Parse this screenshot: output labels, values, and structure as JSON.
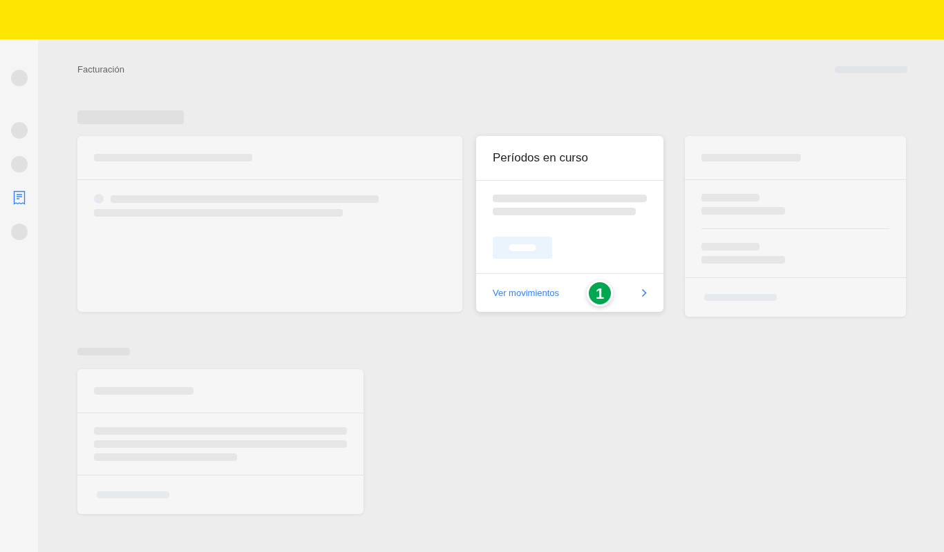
{
  "breadcrumb": "Facturación",
  "sidebar": {
    "items": [
      {
        "selected": false
      },
      {
        "selected": false
      },
      {
        "selected": false
      },
      {
        "selected": true
      },
      {
        "selected": false
      }
    ]
  },
  "current_periods_card": {
    "title": "Períodos en curso",
    "link": "Ver movimientos",
    "step_badge": "1"
  }
}
